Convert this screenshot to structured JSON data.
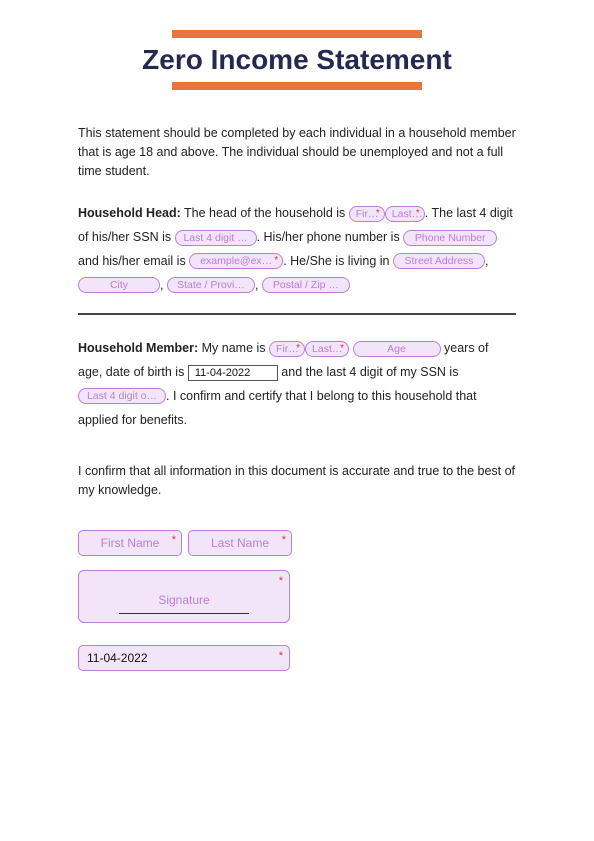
{
  "title": "Zero Income Statement",
  "intro": "This statement should be completed by each individual in a household member that is age 18 and above. The individual should be unemployed and not a full time student.",
  "head": {
    "label": "Household Head:",
    "t1": "The head of the household is",
    "firstName": "Fir…",
    "lastName": "Last…",
    "t2": ". The last 4 digit of his/her SSN is",
    "ssn": "Last 4 digit …",
    "t3": ". His/her phone number is",
    "phone": "Phone Number",
    "t4": "and his/her email is",
    "email": "example@ex…",
    "t5": ". He/She is living in",
    "street": "Street Address",
    "city": "City",
    "state": "State / Provi…",
    "postal": "Postal / Zip …"
  },
  "member": {
    "label": "Household Member:",
    "t1": "My name is",
    "firstName": "Fir…",
    "lastName": "Last…",
    "age": "Age",
    "t2": "years of age, date of birth is",
    "dob": "11-04-2022",
    "t3": "and the last 4 digit of my SSN is",
    "ssn": "Last 4 digit o…",
    "t4": ". I confirm and certify that I belong to this household that applied for benefits."
  },
  "confirm": "I confirm that all information in this document is accurate and true to the best of my knowledge.",
  "sign": {
    "firstName": "First Name",
    "lastName": "Last Name",
    "signature": "Signature",
    "date": "11-04-2022"
  }
}
